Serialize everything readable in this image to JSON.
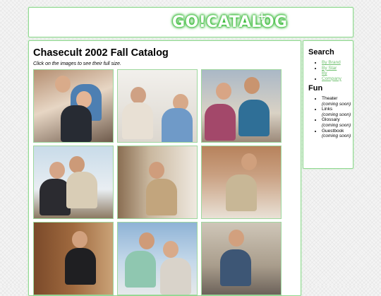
{
  "header": {
    "logo_text": "GO!CATALOG",
    "logo_plus": "+"
  },
  "main": {
    "title": "Chasecult 2002 Fall Catalog",
    "instructions": "Click on the images to see their full size."
  },
  "sidebar": {
    "search_heading": "Search",
    "search_links": [
      "By Brand",
      "By Star",
      "By Company"
    ],
    "fun_heading": "Fun",
    "fun_items": [
      {
        "label": "Theater",
        "note": "(coming soon)"
      },
      {
        "label": "Links",
        "note": "(coming soon)"
      },
      {
        "label": "Glossary",
        "note": "(coming soon)"
      },
      {
        "label": "Guestbook",
        "note": "(coming soon)"
      }
    ]
  },
  "colors": {
    "accent": "#8fd88f",
    "link": "#6fc06f",
    "logo_glow": "#3bbf3b"
  }
}
